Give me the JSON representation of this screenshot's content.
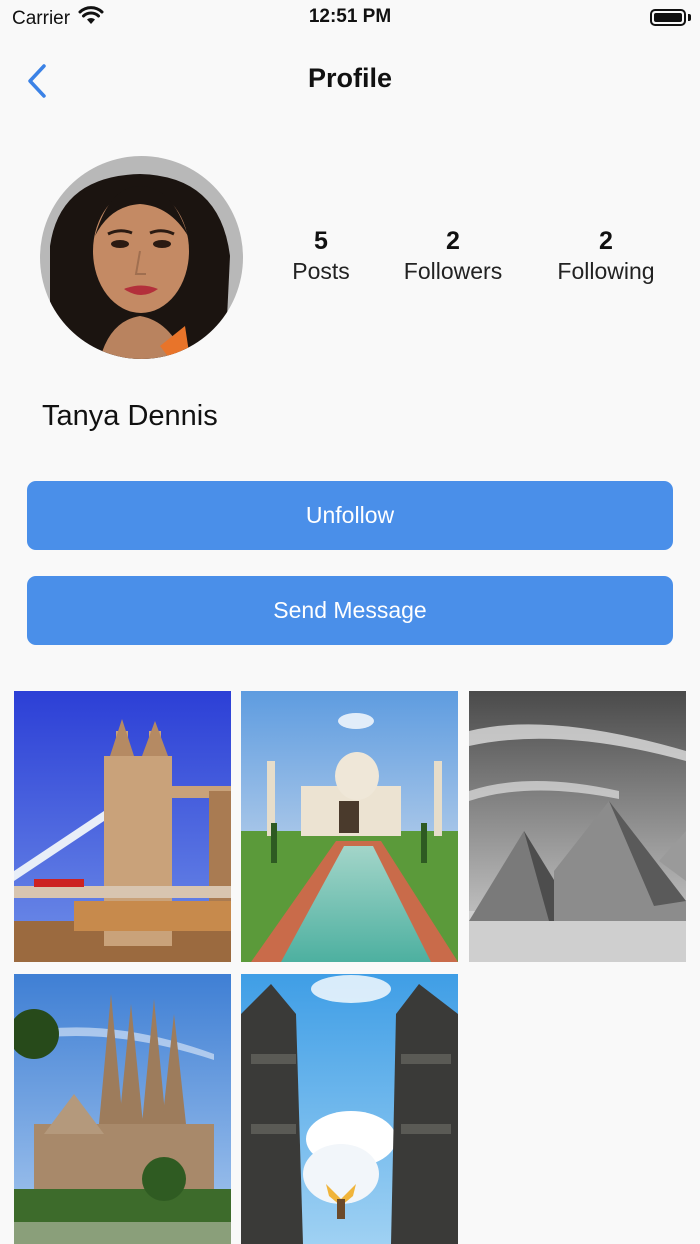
{
  "status_bar": {
    "carrier": "Carrier",
    "time": "12:51 PM"
  },
  "nav": {
    "title": "Profile"
  },
  "profile": {
    "name": "Tanya Dennis",
    "stats": [
      {
        "value": "5",
        "label": "Posts"
      },
      {
        "value": "2",
        "label": "Followers"
      },
      {
        "value": "2",
        "label": "Following"
      }
    ]
  },
  "actions": {
    "unfollow_label": "Unfollow",
    "message_label": "Send Message"
  },
  "colors": {
    "accent": "#4a8fe9",
    "background": "#f9f9f9"
  },
  "icons": {
    "back": "chevron-left-icon",
    "wifi": "wifi-icon",
    "battery": "battery-icon"
  }
}
